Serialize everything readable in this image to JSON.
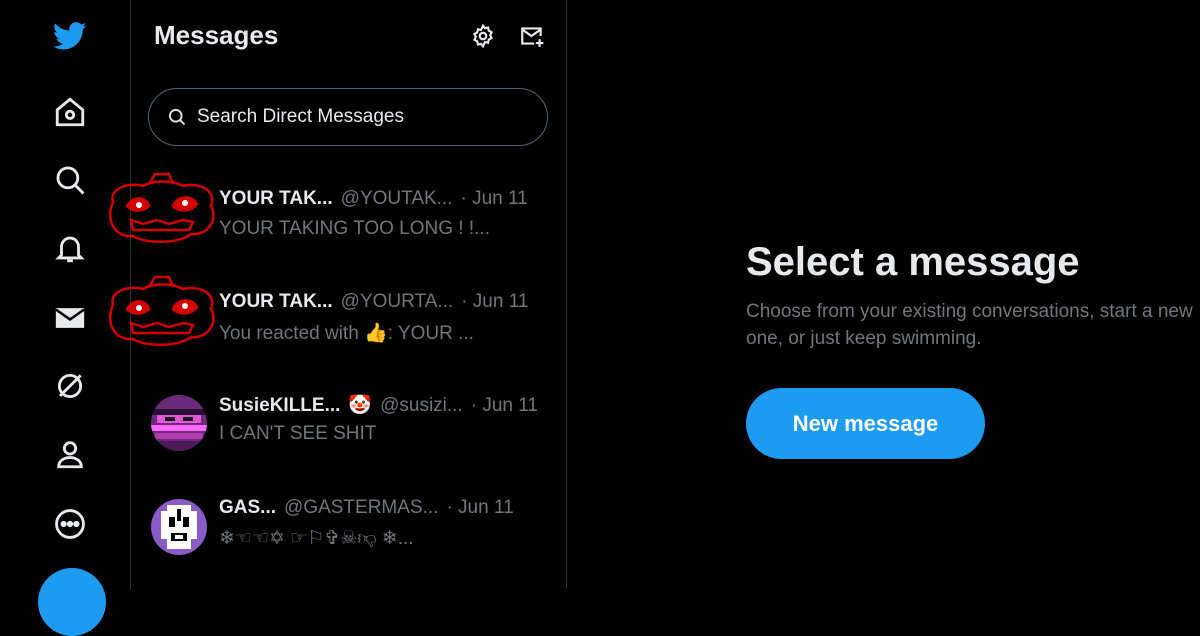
{
  "nav": {
    "items": [
      {
        "icon": "twitter-bird-icon"
      },
      {
        "icon": "home-icon"
      },
      {
        "icon": "explore-icon"
      },
      {
        "icon": "notifications-icon"
      },
      {
        "icon": "messages-icon"
      },
      {
        "icon": "spaces-icon"
      },
      {
        "icon": "profile-icon"
      },
      {
        "icon": "more-icon"
      }
    ]
  },
  "messages": {
    "title": "Messages",
    "search_placeholder": "Search Direct Messages",
    "conversations": [
      {
        "name": "YOUR TAK...",
        "handle": "@YOUTAK...",
        "date": "· Jun 11",
        "preview": "YOUR TAKING TOO LONG ! !..."
      },
      {
        "name": "YOUR TAK...",
        "handle": "@YOURTA...",
        "date": "· Jun 11",
        "preview": "You reacted with 👍: YOUR ..."
      },
      {
        "name": "SusieKILLE...",
        "emoji": "🤡",
        "handle": "@susizi...",
        "date": "· Jun 11",
        "preview": "I CAN'T SEE SHIT"
      },
      {
        "name": "GAS...",
        "handle": "@GASTERMAS...",
        "date": "· Jun 11",
        "preview": "❄︎☜☜✡︎    ☞⚐✞☠︎👎︎     ❄︎..."
      }
    ]
  },
  "detail": {
    "title": "Select a message",
    "subtitle": "Choose from your existing conversations, start a new one, or just keep swimming.",
    "button": "New message"
  },
  "colors": {
    "accent": "#1d9bf0",
    "background": "#000000",
    "muted": "#71767b",
    "text": "#e7e9ea"
  }
}
